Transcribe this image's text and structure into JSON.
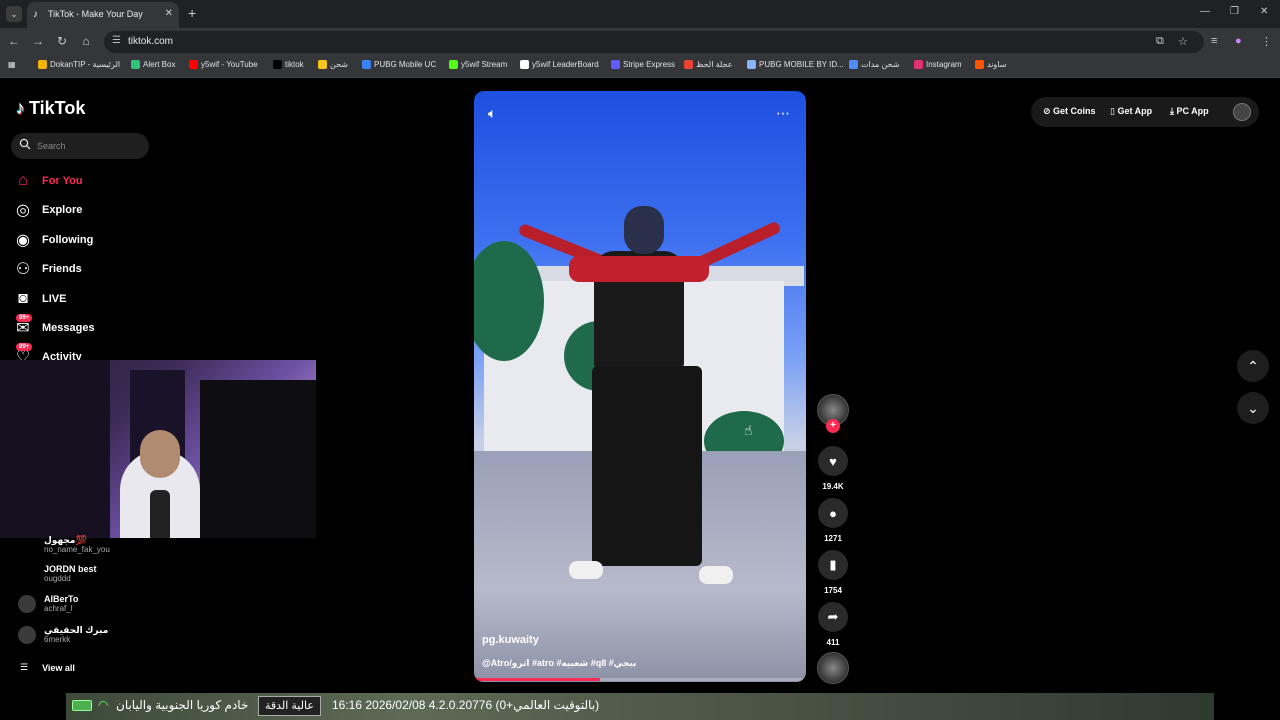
{
  "browser": {
    "tab_title": "TikTok - Make Your Day",
    "url": "tiktok.com",
    "bookmarks": [
      {
        "label": "DokanTIP - الرئيسية",
        "color": "#f4b400"
      },
      {
        "label": "Alert Box",
        "color": "#31c27c"
      },
      {
        "label": "y5wif - YouTube",
        "color": "#ff0000"
      },
      {
        "label": "tiktok",
        "color": "#000000"
      },
      {
        "label": "شحن",
        "color": "#f5c518"
      },
      {
        "label": "PUBG Mobile UC",
        "color": "#3b82f6"
      },
      {
        "label": "y5wif Stream",
        "color": "#53fc18"
      },
      {
        "label": "y5wif LeaderBoard",
        "color": "#ffffff"
      },
      {
        "label": "Stripe Express",
        "color": "#635bff"
      },
      {
        "label": "عجلة الحظ",
        "color": "#ea4335"
      },
      {
        "label": "PUBG MOBILE BY ID...",
        "color": "#8ab4f8"
      },
      {
        "label": "شحن مدات",
        "color": "#4f8ef7"
      },
      {
        "label": "Instagram",
        "color": "#e1306c"
      },
      {
        "label": "ساوند",
        "color": "#ff5500"
      }
    ]
  },
  "tiktok": {
    "logo_text": "TikTok",
    "search_placeholder": "Search",
    "nav": [
      {
        "label": "For You",
        "icon": "home-icon"
      },
      {
        "label": "Explore",
        "icon": "compass-icon"
      },
      {
        "label": "Following",
        "icon": "following-avatar-icon"
      },
      {
        "label": "Friends",
        "icon": "friends-icon"
      },
      {
        "label": "LIVE",
        "icon": "live-icon"
      },
      {
        "label": "Messages",
        "icon": "messages-icon",
        "badge": "99+"
      },
      {
        "label": "Activity",
        "icon": "activity-icon",
        "badge": "99+"
      }
    ],
    "following_accounts": [
      {
        "name": "مجهول💯",
        "handle": "no_name_fak_you"
      },
      {
        "name": "JORDN best",
        "handle": "ougddd"
      },
      {
        "name": "AlBerTo",
        "handle": "achraf_l"
      },
      {
        "name": "مبرك الحقيقي",
        "handle": "6merkk"
      }
    ],
    "view_all": "View all",
    "top_right": {
      "get_coins": "Get Coins",
      "get_app": "Get App",
      "pc_app": "PC App"
    },
    "video": {
      "author": "pg.kuwaity",
      "caption": "@Atro/اترو #atro #شعبيه #q8 #ببجي",
      "progress": 0.38,
      "likes": "19.4K",
      "comments": "1271",
      "saves": "1754",
      "shares": "411"
    }
  },
  "overlay": {
    "server": "خادم كوريا الجنوبية واليابان",
    "quality": "عالية الدقة",
    "timestamp": "16:16 2026/02/08 4.2.0.20776 (بالتوقيت العالمي+0)",
    "battery_level": 1.0
  }
}
